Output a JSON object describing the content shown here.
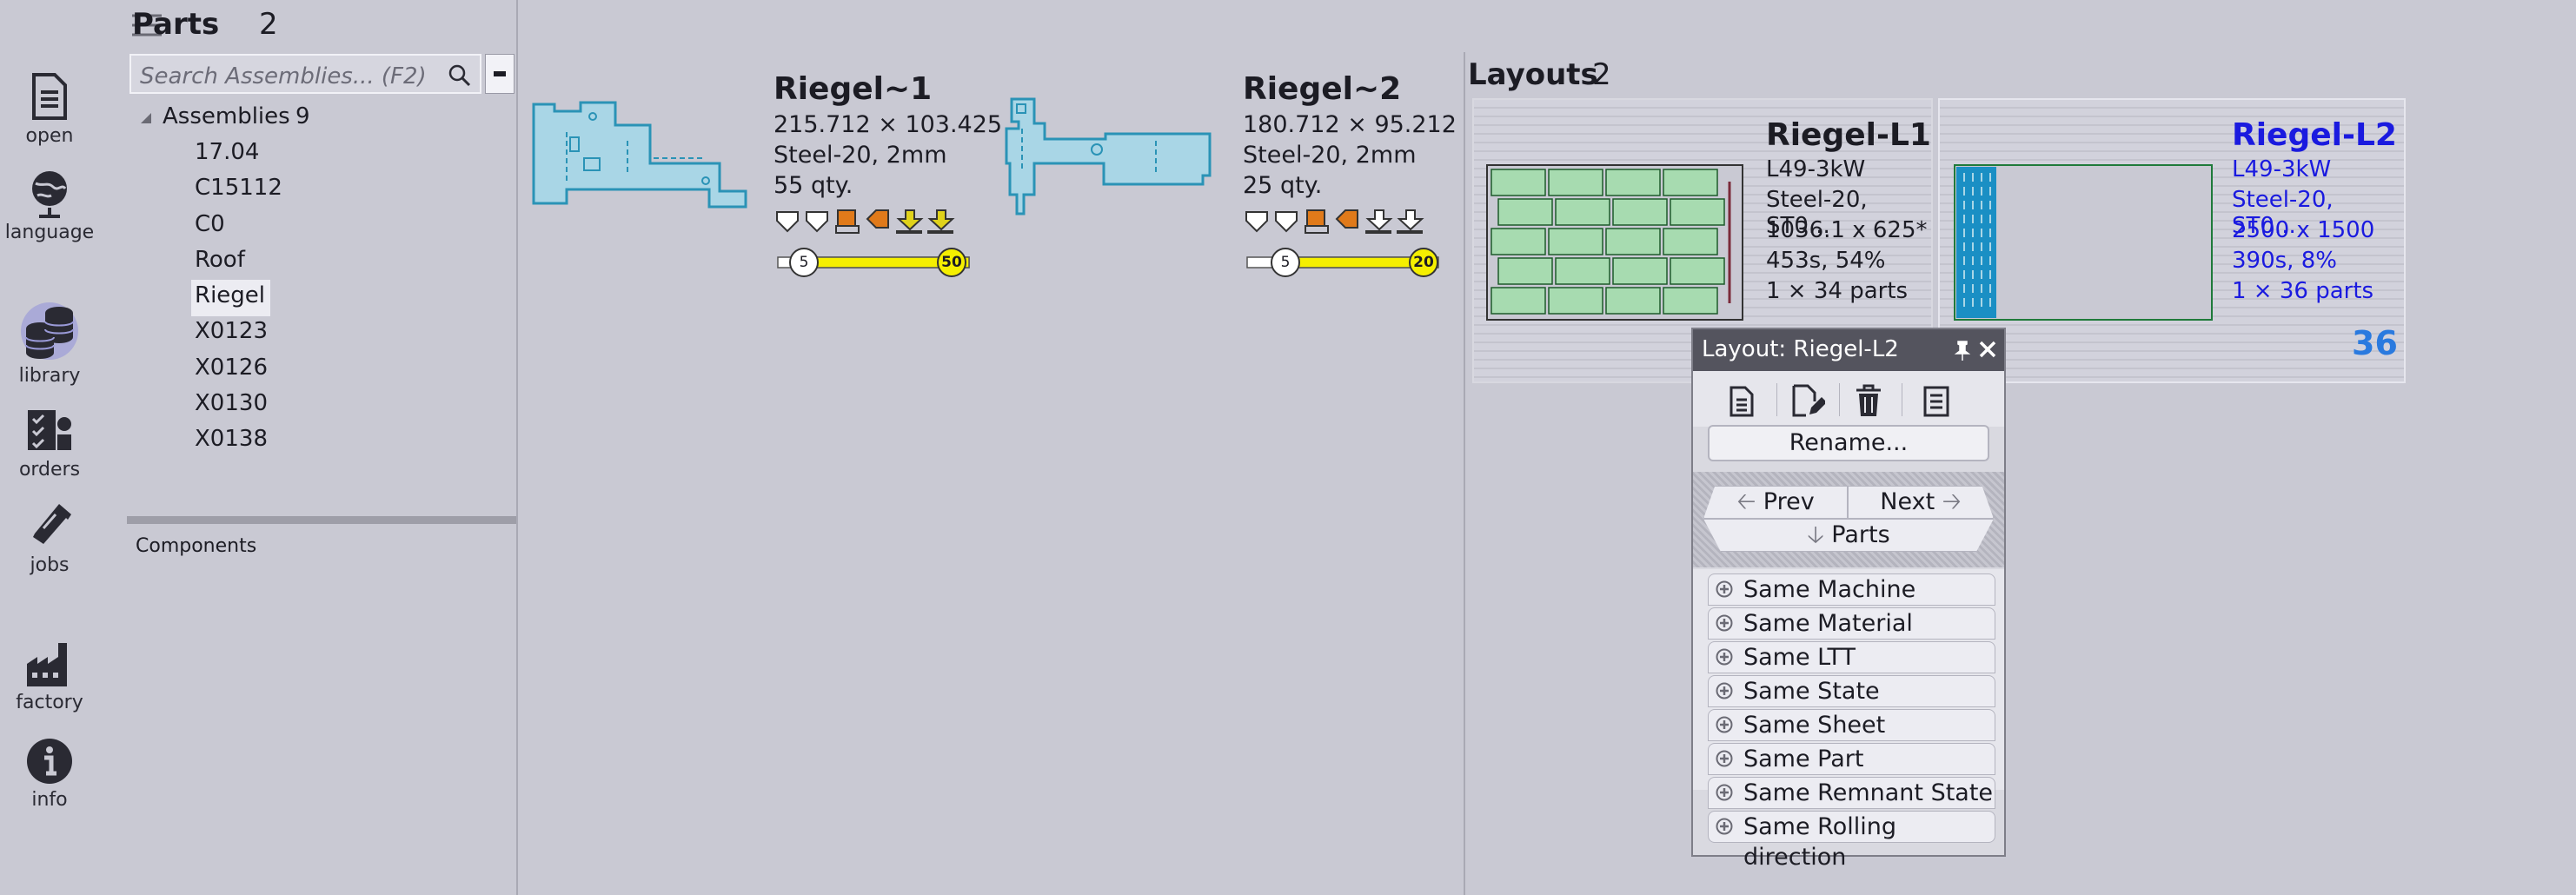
{
  "nav": {
    "items": [
      {
        "label": "open",
        "icon": "document-icon"
      },
      {
        "label": "language",
        "icon": "globe-icon"
      },
      {
        "label": "library",
        "icon": "database-icon"
      },
      {
        "label": "orders",
        "icon": "orders-icon"
      },
      {
        "label": "jobs",
        "icon": "ticket-icon"
      },
      {
        "label": "factory",
        "icon": "factory-icon"
      },
      {
        "label": "info",
        "icon": "info-icon"
      }
    ]
  },
  "parts": {
    "title": "Parts",
    "count": "2",
    "search_placeholder": "Search Assemblies... (F2)",
    "tree_root_label": "Assemblies",
    "tree_root_count": "9",
    "assemblies": [
      "17.04",
      "C15112",
      "C0",
      "Roof",
      "Riegel",
      "X0123",
      "X0126",
      "X0130",
      "X0138"
    ],
    "selected_assembly": "Riegel",
    "components_label": "Components",
    "cards": [
      {
        "name": "Riegel~1",
        "dims": "215.712 × 103.425",
        "material": "Steel-20, 2mm",
        "qty": "55 qty.",
        "slider_min": "5",
        "slider_max": "50",
        "slider_level": 1.0
      },
      {
        "name": "Riegel~2",
        "dims": "180.712 × 95.212",
        "material": "Steel-20, 2mm",
        "qty": "25 qty.",
        "slider_min": "5",
        "slider_max": "20",
        "slider_level": 1.0
      }
    ]
  },
  "layouts": {
    "title": "Layouts",
    "count": "2",
    "cards": [
      {
        "name": "Riegel-L1",
        "machine": "L49-3kW",
        "material": "Steel-20, ST0...",
        "sheet": "1036.1 x 625*",
        "time": "453s, 54%",
        "parts": "1 × 34 parts",
        "badge": ""
      },
      {
        "name": "Riegel-L2",
        "machine": "L49-3kW",
        "material": "Steel-20, ST0...",
        "sheet": "2500 x 1500",
        "time": "390s, 8%",
        "parts": "1 × 36 parts",
        "badge": "36"
      }
    ]
  },
  "popup": {
    "title_prefix": "Layout:",
    "title_name": "Riegel-L2",
    "rename_label": "Rename...",
    "prev_label": "Prev",
    "next_label": "Next",
    "parts_label": "Parts",
    "same_items": [
      "Same Machine",
      "Same Material",
      "Same LTT",
      "Same State",
      "Same Sheet",
      "Same Part",
      "Same Remnant State",
      "Same Rolling direction"
    ]
  },
  "colors": {
    "accent_blue": "#1a1adf",
    "badge_blue": "#2a7adf",
    "part_fill": "#a9d6e6",
    "part_stroke": "#2a93b6",
    "slider_yellow": "#f5ef00",
    "warn_orange": "#e07a1a",
    "nest_green": "#a7dbb0"
  }
}
